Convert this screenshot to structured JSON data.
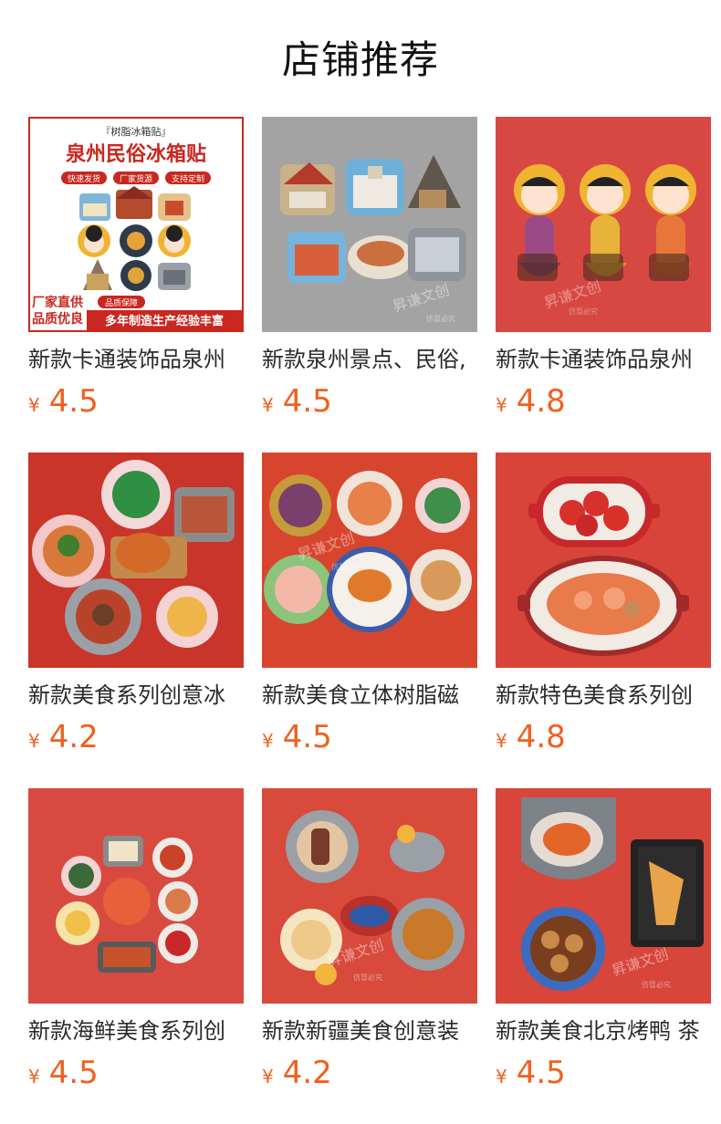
{
  "header": {
    "title": "店铺推荐"
  },
  "products": [
    {
      "name": "新款卡通装饰品泉州",
      "currency": "¥",
      "price": "4.5",
      "image_text": {
        "tag": "『树脂冰箱贴』",
        "headline": "泉州民俗冰箱贴",
        "chips": [
          "快速发货",
          "厂家货源",
          "支持定制"
        ],
        "promo_left_1": "厂家直供",
        "promo_left_2": "品质优良",
        "promo_badge": "品质保障",
        "promo_banner": "多年制造生产经验丰富"
      }
    },
    {
      "name": "新款泉州景点、民俗,",
      "currency": "¥",
      "price": "4.5",
      "image_text": {
        "watermark": "昇谦文创",
        "watermark_sub": "仿冒必究"
      }
    },
    {
      "name": "新款卡通装饰品泉州",
      "currency": "¥",
      "price": "4.8",
      "image_text": {
        "watermark": "昇谦文创",
        "watermark_sub": "仿冒必究"
      }
    },
    {
      "name": "新款美食系列创意冰",
      "currency": "¥",
      "price": "4.2"
    },
    {
      "name": "新款美食立体树脂磁",
      "currency": "¥",
      "price": "4.5",
      "image_text": {
        "watermark": "昇谦文创",
        "watermark_sub": "仿冒必究"
      }
    },
    {
      "name": "新款特色美食系列创",
      "currency": "¥",
      "price": "4.8"
    },
    {
      "name": "新款海鲜美食系列创",
      "currency": "¥",
      "price": "4.5"
    },
    {
      "name": "新款新疆美食创意装",
      "currency": "¥",
      "price": "4.2",
      "image_text": {
        "watermark": "昇谦文创",
        "watermark_sub": "仿冒必究"
      }
    },
    {
      "name": "新款美食北京烤鸭 茶",
      "currency": "¥",
      "price": "4.5",
      "image_text": {
        "watermark": "昇谦文创",
        "watermark_sub": "仿冒必究"
      }
    }
  ]
}
